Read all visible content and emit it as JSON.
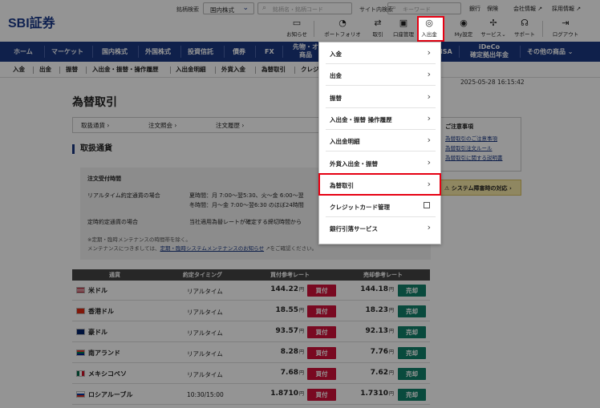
{
  "header": {
    "logo": "SBI証券",
    "stock_search_label": "銘柄検索",
    "market_select": "国内株式",
    "stock_search_placeholder": "銘柄名・銘柄コード",
    "site_search_label": "サイト内検索",
    "site_search_placeholder": "キーワード",
    "top_links": [
      "銀行",
      "保険",
      "会社情報",
      "採用情報"
    ],
    "icon_buttons": [
      {
        "label": "お知らせ",
        "icon": "chat-icon"
      },
      {
        "label": "ポートフォリオ",
        "icon": "pie-chart-icon"
      },
      {
        "label": "取引",
        "icon": "exchange-icon"
      },
      {
        "label": "口座管理",
        "icon": "wallet-icon"
      },
      {
        "label": "入出金",
        "icon": "yen-circle-icon"
      },
      {
        "label": "My設定",
        "icon": "user-settings-icon"
      },
      {
        "label": "サービス",
        "icon": "service-icon"
      },
      {
        "label": "サポート",
        "icon": "headset-icon"
      },
      {
        "label": "ログアウト",
        "icon": "logout-icon"
      }
    ]
  },
  "nav": {
    "items": [
      "ホーム",
      "マーケット",
      "国内株式",
      "外国株式",
      "投資信託",
      "債券",
      "FX",
      "先物・オ",
      "商品",
      "iSA",
      "iDeCo",
      "確定拠出年金",
      "その他の商品"
    ]
  },
  "subnav": {
    "items": [
      "入金",
      "出金",
      "振替",
      "入出金・振替・操作履歴",
      "入出金明細",
      "外貨入金",
      "為替取引",
      "クレジ"
    ]
  },
  "datetime": "2025-05-28 16:15:42",
  "page": {
    "title": "為替取引",
    "crumbs": [
      "取扱通貨",
      "注文照会",
      "注文履歴"
    ],
    "section_title": "取扱通貨",
    "info": {
      "heading": "注文受付時間",
      "realtime_label": "リアルタイム約定通貨の場合",
      "summer": "夏時間：月 7:00〜翌5:30、火〜金 6:00〜翌",
      "winter": "冬時間：月〜金 7:00〜翌6:30 のほぼ24時間",
      "fixed_label": "定時約定通貨の場合",
      "fixed_text": "当社適用為替レートが確定する締切時間から",
      "note1": "※定期・臨時メンテナンスの時間帯を除く。",
      "note2_pre": "メンテナンスにつきましては、",
      "note2_link": "定期・臨時システムメンテナンスのお知らせ",
      "note2_post": "をご確認ください。"
    },
    "notice": {
      "title": "ご注意事項",
      "links": [
        "為替取引のご注意事項",
        "為替取引注文ルール",
        "為替取引に関する説明書"
      ]
    },
    "alert_button": "システム障害時の対応"
  },
  "table": {
    "headers": [
      "通貨",
      "約定タイミング",
      "買付参考レート",
      "売却参考レート"
    ],
    "buy_label": "買付",
    "sell_label": "売却",
    "yen_unit": "円",
    "rows": [
      {
        "currency": "米ドル",
        "timing": "リアルタイム",
        "buy": "144.22",
        "sell": "144.18"
      },
      {
        "currency": "香港ドル",
        "timing": "リアルタイム",
        "buy": "18.55",
        "sell": "18.23"
      },
      {
        "currency": "豪ドル",
        "timing": "リアルタイム",
        "buy": "93.57",
        "sell": "92.13"
      },
      {
        "currency": "南アランド",
        "timing": "リアルタイム",
        "buy": "8.28",
        "sell": "7.76"
      },
      {
        "currency": "メキシコペソ",
        "timing": "リアルタイム",
        "buy": "7.68",
        "sell": "7.62"
      },
      {
        "currency": "ロシアルーブル",
        "timing": "10:30/15:00",
        "buy": "1.8710",
        "sell": "1.7310"
      }
    ]
  },
  "dropdown": {
    "items": [
      "入金",
      "出金",
      "振替",
      "入出金・振替 操作履歴",
      "入出金明細",
      "外貨入出金・振替",
      "為替取引",
      "クレジットカード管理",
      "銀行引落サービス"
    ]
  },
  "colors": {
    "brand_navy": "#1a3782",
    "buy_red": "#d0103a",
    "sell_green": "#10806a",
    "highlight_red": "#e60012"
  }
}
